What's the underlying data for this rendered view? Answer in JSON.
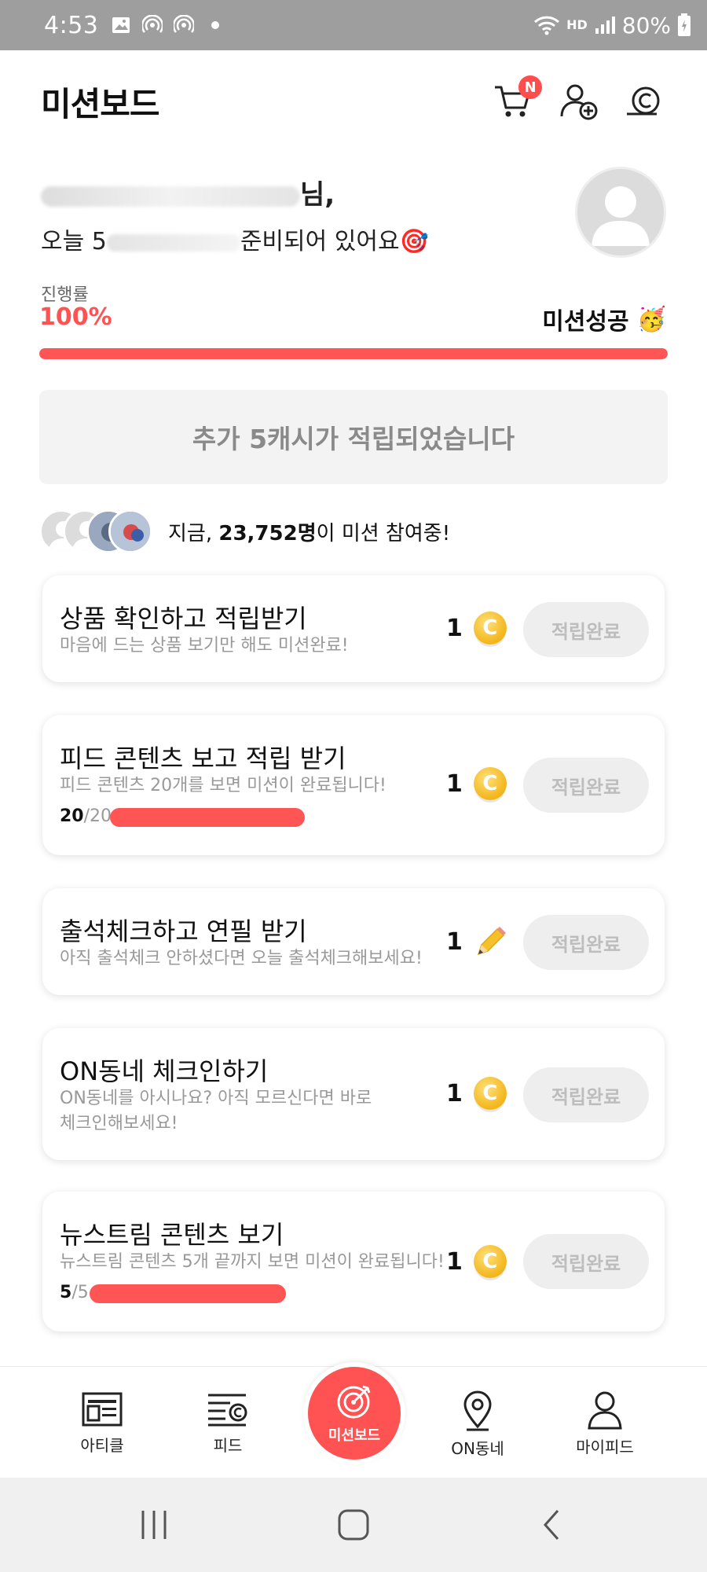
{
  "status_bar": {
    "time": "4:53",
    "battery": "80%",
    "network": "HD"
  },
  "header": {
    "title": "미션보드",
    "cart_badge": "N"
  },
  "greeting": {
    "name_suffix": "님,",
    "message_prefix": "오늘 5",
    "message_suffix": "준비되어 있어요🎯"
  },
  "progress": {
    "label": "진행률",
    "value": "100%",
    "fraction": 1.0,
    "status": "미션성공",
    "status_emoji": "🥳"
  },
  "notice": {
    "text": "추가 5캐시가 적립되었습니다"
  },
  "participants": {
    "prefix": "지금, ",
    "count": "23,752명",
    "suffix": "이 미션 참여중!"
  },
  "missions": [
    {
      "title": "상품 확인하고 적립받기",
      "desc": "마음에 드는 상품 보기만 해도 미션완료!",
      "reward": "1",
      "reward_icon": "coin-icon",
      "button": "적립완료"
    },
    {
      "title": "피드 콘텐츠 보고 적립 받기",
      "desc": "피드 콘텐츠 20개를 보면 미션이 완료됩니다!",
      "progress_done": "20",
      "progress_total": "/20",
      "progress_fraction": 1.0,
      "reward": "1",
      "reward_icon": "coin-icon",
      "button": "적립완료"
    },
    {
      "title": "출석체크하고 연필 받기",
      "desc": "아직 출석체크 안하셨다면 오늘 출석체크해보세요!",
      "reward": "1",
      "reward_icon": "pencil-icon",
      "button": "적립완료"
    },
    {
      "title": "ON동네 체크인하기",
      "desc_line1": "ON동네를 아시나요? 아직 모르신다면 바로",
      "desc_line2": "체크인해보세요!",
      "reward": "1",
      "reward_icon": "coin-icon",
      "button": "적립완료"
    },
    {
      "title": "뉴스트림 콘텐츠 보기",
      "desc": "뉴스트림 콘텐츠 5개 끝까지 보면 미션이 완료됩니다!",
      "progress_done": "5",
      "progress_total": "/5",
      "progress_fraction": 1.0,
      "reward": "1",
      "reward_icon": "coin-icon",
      "button": "적립완료"
    }
  ],
  "bottom_nav": {
    "article": "아티클",
    "feed": "피드",
    "missionboard": "미션보드",
    "on_dongne": "ON동네",
    "myfeed": "마이피드"
  },
  "colors": {
    "accent": "#ff5252",
    "coin": "#f3b51a",
    "muted": "#999999"
  }
}
